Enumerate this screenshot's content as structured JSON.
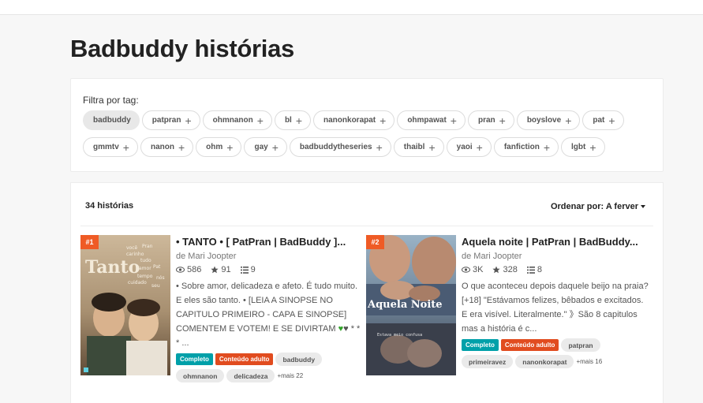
{
  "page": {
    "title": "Badbuddy histórias"
  },
  "filter": {
    "label": "Filtra por tag:",
    "row1": [
      "badbuddy",
      "patpran",
      "ohmnanon",
      "bl",
      "nanonkorapat",
      "ohmpawat",
      "pran",
      "boyslove",
      "pat"
    ],
    "row2": [
      "gmmtv",
      "nanon",
      "ohm",
      "gay",
      "badbuddytheseries",
      "thaibl",
      "yaoi",
      "fanfiction",
      "lgbt"
    ]
  },
  "list": {
    "count": "34 histórias",
    "sort_label": "Ordenar por:",
    "sort_value": "A ferver"
  },
  "stories": [
    {
      "rank": "#1",
      "title": "• TANTO • [ PatPran | BadBuddy ]...",
      "author": "de Mari Joopter",
      "views": "586",
      "votes": "91",
      "parts": "9",
      "description": "• Sobre amor, delicadeza e afeto. É tudo muito. E eles são tanto. • [LEIA A SINOPSE NO CAPITULO PRIMEIRO - CAPA E SINOPSE] COMENTEM E VOTEM! E SE DIVIRTAM",
      "desc_tail": "* * * ...",
      "badge_complete": "Completo",
      "badge_adult": "Conteúdo adulto",
      "tags": [
        "badbuddy",
        "ohmnanon",
        "delicadeza"
      ],
      "more": "+mais 22",
      "cover_title": "Tanto",
      "cover_words": [
        "você",
        "Pran",
        "carinho",
        "tudo",
        "amor",
        "Pat",
        "tempo",
        "nós",
        "cuidado",
        "seu"
      ]
    },
    {
      "rank": "#2",
      "title": "Aquela noite | PatPran | BadBuddy...",
      "author": "de Mari Joopter",
      "views": "3K",
      "votes": "328",
      "parts": "8",
      "description": "O que aconteceu depois daquele beijo na praia? [+18] \"Estávamos felizes, bêbados e excitados. E era visível. Literalmente.\" 》São 8 capitulos mas a história é c...",
      "badge_complete": "Completo",
      "badge_adult": "Conteúdo adulto",
      "tags": [
        "patpran",
        "primeiravez",
        "nanonkorapat"
      ],
      "more": "+mais 16",
      "cover_title": "Aquela Noite",
      "cover_sub": "Estava meio confusa"
    }
  ],
  "colors": {
    "accent": "#ef5b25",
    "complete": "#00a0a9",
    "adult": "#e14c1f"
  }
}
